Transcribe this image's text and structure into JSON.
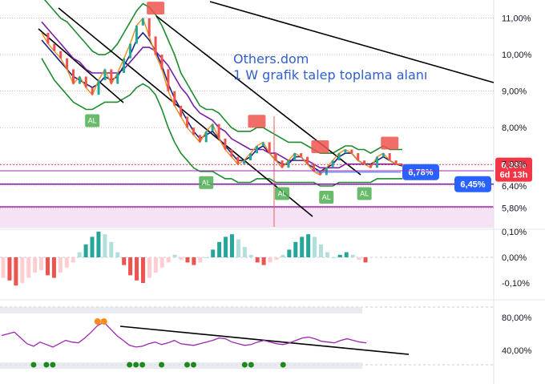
{
  "chart_data": {
    "type": "line",
    "annotation": {
      "line1": "Others.dom",
      "line2": "1 W grafik talep toplama alanı"
    },
    "price_axis": {
      "ticks": [
        "11,00%",
        "10,00%",
        "9,00%",
        "8,00%",
        "7,00%",
        "6,40%",
        "5,80%"
      ],
      "last_price_tag": {
        "value": "6,98%",
        "countdown": "6d 13h",
        "color": "#f23645"
      },
      "level_tags": [
        {
          "value": "6,78%",
          "color": "#2962ff"
        },
        {
          "value": "6,45%",
          "color": "#2962ff"
        }
      ]
    },
    "price_series": {
      "close": [
        10.6,
        10.3,
        10.1,
        9.9,
        9.6,
        9.2,
        9.4,
        9.1,
        8.9,
        9.3,
        9.6,
        9.2,
        9.5,
        9.9,
        10.3,
        10.8,
        11.0,
        10.5,
        10.0,
        9.6,
        9.0,
        8.6,
        8.3,
        8.0,
        7.8,
        7.6,
        7.9,
        8.1,
        7.7,
        7.4,
        7.2,
        7.0,
        7.1,
        7.3,
        7.5,
        7.6,
        7.3,
        7.1,
        6.9,
        7.1,
        7.3,
        7.2,
        7.0,
        6.8,
        6.7,
        6.9,
        7.1,
        7.3,
        7.4,
        7.3,
        7.1,
        7.0,
        6.9,
        7.2,
        7.3,
        7.1,
        7.0,
        6.98
      ],
      "ma_fast": [
        10.4,
        10.2,
        10.0,
        9.8,
        9.6,
        9.4,
        9.3,
        9.2,
        9.1,
        9.2,
        9.4,
        9.3,
        9.4,
        9.7,
        10.0,
        10.4,
        10.6,
        10.4,
        10.1,
        9.7,
        9.2,
        8.8,
        8.5,
        8.2,
        7.9,
        7.7,
        7.8,
        7.9,
        7.7,
        7.5,
        7.3,
        7.1,
        7.1,
        7.2,
        7.4,
        7.5,
        7.3,
        7.1,
        7.0,
        7.0,
        7.2,
        7.2,
        7.0,
        6.9,
        6.8,
        6.9,
        7.0,
        7.2,
        7.3,
        7.3,
        7.1,
        7.0,
        7.0,
        7.1,
        7.2,
        7.1,
        7.0,
        6.95
      ],
      "ma_slow": [
        10.9,
        10.7,
        10.5,
        10.3,
        10.1,
        9.9,
        9.8,
        9.6,
        9.5,
        9.5,
        9.5,
        9.5,
        9.5,
        9.6,
        9.8,
        10.0,
        10.2,
        10.2,
        10.1,
        9.9,
        9.7,
        9.4,
        9.1,
        8.9,
        8.6,
        8.4,
        8.3,
        8.2,
        8.0,
        7.9,
        7.7,
        7.6,
        7.5,
        7.4,
        7.4,
        7.4,
        7.3,
        7.3,
        7.2,
        7.1,
        7.1,
        7.1,
        7.1,
        7.0,
        6.9,
        6.9,
        6.9,
        6.9,
        7.0,
        7.0,
        7.0,
        7.0,
        7.0,
        7.0,
        7.0,
        7.0,
        7.0,
        7.0
      ],
      "band_upper": [
        11.6,
        11.4,
        11.2,
        11.0,
        10.9,
        10.7,
        10.5,
        10.3,
        10.1,
        10.0,
        10.0,
        10.1,
        10.3,
        10.6,
        10.9,
        11.2,
        11.4,
        11.3,
        11.1,
        10.8,
        10.4,
        10.0,
        9.5,
        9.2,
        8.9,
        8.6,
        8.5,
        8.5,
        8.4,
        8.2,
        8.0,
        7.9,
        7.9,
        7.9,
        8.0,
        8.0,
        7.9,
        7.8,
        7.7,
        7.6,
        7.6,
        7.6,
        7.5,
        7.4,
        7.3,
        7.3,
        7.3,
        7.4,
        7.5,
        7.5,
        7.4,
        7.4,
        7.3,
        7.4,
        7.5,
        7.4,
        7.4,
        7.4
      ],
      "band_lower": [
        9.9,
        9.6,
        9.3,
        9.1,
        8.9,
        8.7,
        8.6,
        8.5,
        8.5,
        8.6,
        8.7,
        8.7,
        8.7,
        8.8,
        8.9,
        9.1,
        9.2,
        9.1,
        8.9,
        8.5,
        8.0,
        7.6,
        7.3,
        7.1,
        6.9,
        6.8,
        6.8,
        6.8,
        6.7,
        6.6,
        6.6,
        6.5,
        6.5,
        6.5,
        6.6,
        6.6,
        6.6,
        6.5,
        6.5,
        6.5,
        6.5,
        6.5,
        6.5,
        6.5,
        6.4,
        6.4,
        6.4,
        6.5,
        6.5,
        6.5,
        6.5,
        6.5,
        6.5,
        6.6,
        6.6,
        6.6,
        6.6,
        6.6
      ]
    },
    "signals": [
      {
        "label": "AL",
        "type": "buy",
        "i": 8
      },
      {
        "label": "AL",
        "type": "buy",
        "i": 26
      },
      {
        "label": "AL",
        "type": "buy",
        "i": 38
      },
      {
        "label": "AL",
        "type": "buy",
        "i": 45
      },
      {
        "label": "AL",
        "type": "buy",
        "i": 51
      },
      {
        "label": "",
        "type": "sell",
        "i": 18
      },
      {
        "label": "",
        "type": "sell",
        "i": 34
      },
      {
        "label": "",
        "type": "sell",
        "i": 44
      },
      {
        "label": "",
        "type": "sell",
        "i": 55
      }
    ],
    "histogram_axis": {
      "ticks": [
        "0,10%",
        "0,00%",
        "-0,10%"
      ]
    },
    "histogram": [
      -0.08,
      -0.09,
      -0.11,
      -0.1,
      -0.08,
      -0.06,
      -0.05,
      -0.07,
      -0.08,
      -0.06,
      -0.04,
      -0.02,
      0.02,
      0.05,
      0.08,
      0.1,
      0.09,
      0.06,
      0.02,
      -0.03,
      -0.07,
      -0.09,
      -0.1,
      -0.08,
      -0.06,
      -0.04,
      -0.02,
      0.01,
      -0.01,
      -0.02,
      -0.03,
      -0.02,
      0.0,
      0.03,
      0.06,
      0.08,
      0.09,
      0.07,
      0.04,
      0.01,
      -0.02,
      -0.03,
      -0.02,
      -0.01,
      0.01,
      0.03,
      0.06,
      0.08,
      0.09,
      0.08,
      0.05,
      0.02,
      0.0,
      0.01,
      0.02,
      0.01,
      -0.01,
      -0.02
    ],
    "oscillator_axis": {
      "ticks": [
        "80,00%",
        "40,00%"
      ]
    },
    "oscillator": [
      58,
      60,
      62,
      55,
      48,
      45,
      50,
      47,
      44,
      48,
      52,
      50,
      49,
      55,
      62,
      70,
      74,
      66,
      58,
      52,
      46,
      44,
      45,
      48,
      50,
      47,
      49,
      52,
      48,
      47,
      46,
      48,
      50,
      52,
      55,
      54,
      50,
      48,
      46,
      47,
      50,
      52,
      50,
      48,
      47,
      49,
      52,
      55,
      56,
      54,
      51,
      50,
      49,
      52,
      54,
      52,
      50,
      49
    ]
  }
}
